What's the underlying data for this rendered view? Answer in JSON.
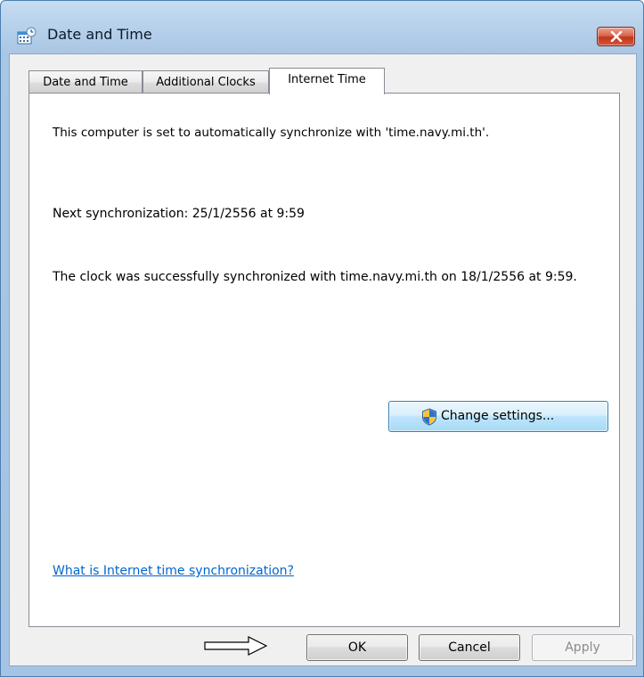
{
  "window": {
    "title": "Date and Time",
    "icon": "calendar-clock-icon",
    "close_icon": "close-icon"
  },
  "tabs": [
    {
      "label": "Date and Time",
      "selected": false
    },
    {
      "label": "Additional Clocks",
      "selected": false
    },
    {
      "label": "Internet Time",
      "selected": true
    }
  ],
  "panel": {
    "sync_message": "This computer is set to automatically synchronize with 'time.navy.mi.th'.",
    "next_sync": "Next synchronization: 25/1/2556 at 9:59",
    "last_sync": "The clock was successfully synchronized with time.navy.mi.th on 18/1/2556 at 9:59.",
    "change_settings_label": "Change settings...",
    "change_settings_icon": "uac-shield-icon",
    "help_link": "What is Internet time synchronization?"
  },
  "buttons": {
    "ok": "OK",
    "cancel": "Cancel",
    "apply": "Apply",
    "apply_enabled": false
  },
  "annotation": {
    "icon": "arrow-right-icon"
  },
  "colors": {
    "link": "#0066cc",
    "close_button": "#c1361c",
    "highlight_button": "#a7d9f5"
  }
}
